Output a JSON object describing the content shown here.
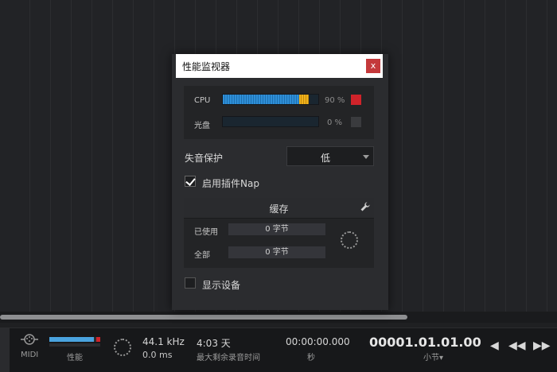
{
  "dialog": {
    "title": "性能监视器",
    "close_label": "x",
    "meters": [
      {
        "label": "CPU",
        "percent_text": "90 %",
        "level": 0.9,
        "led_color": "#d0232a"
      },
      {
        "label": "光盘",
        "percent_text": "0 %",
        "level": 0.0,
        "led_color": "#3a3b3e"
      }
    ],
    "dropout_protection": {
      "label": "失音保护",
      "value": "低"
    },
    "plugin_nap": {
      "label": "启用插件Nap",
      "checked": true
    },
    "cache": {
      "title": "缓存",
      "used_label": "已使用",
      "used_value": "0 字节",
      "total_label": "全部",
      "total_value": "0 字节"
    },
    "show_devices": {
      "label": "显示设备",
      "checked": false
    }
  },
  "transport": {
    "midi_label": "MIDI",
    "perf_label": "性能",
    "sample_rate": "44.1 kHz",
    "latency": "0.0 ms",
    "record_time": "4:03 天",
    "record_time_label": "最大剩余录音时间",
    "seconds_time": "00:00:00.000",
    "seconds_label": "秒",
    "bars_time": "00001.01.01.00",
    "bars_label": "小节▾",
    "buttons": {
      "back": "◀",
      "rewind": "◀◀",
      "forward": "▶▶"
    }
  },
  "colors": {
    "accent": "#2e8fd8",
    "warn": "#f0b21c",
    "alert": "#d0232a",
    "close": "#c4393b"
  },
  "icons": [
    "midi-icon",
    "close-icon",
    "wrench-icon",
    "checkbox-checked-icon",
    "spinner-icon",
    "rewind-icon",
    "forward-icon"
  ]
}
